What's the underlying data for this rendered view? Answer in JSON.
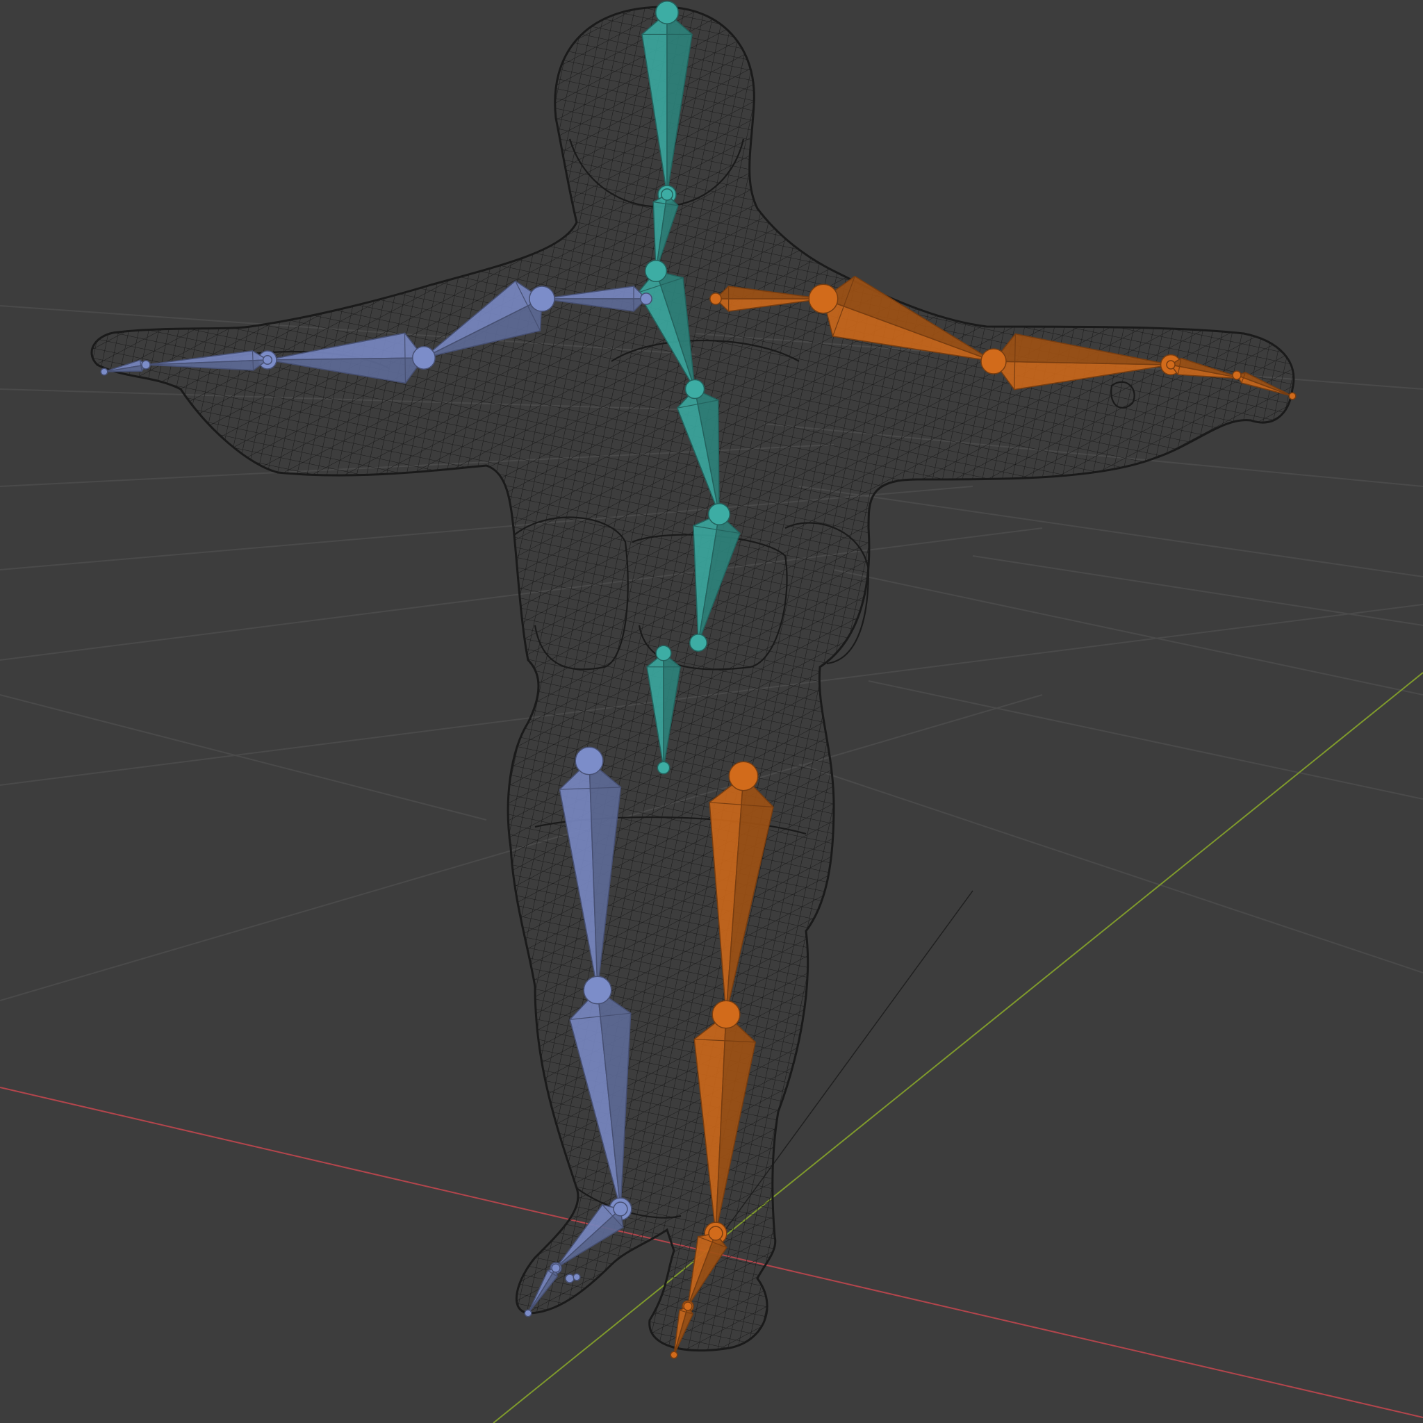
{
  "viewport": {
    "background": "#3d3d3d",
    "grid_color": "#4a4a4a",
    "x_axis_color": "#b3454c",
    "y_axis_color": "#7f9a2c",
    "wire_color": "#1a1a1a"
  },
  "armature": {
    "center_bone_color": "#3aa59c",
    "left_side_color": "#7686bf",
    "right_side_color": "#c8661a",
    "bones": [
      "head",
      "neck",
      "spine_upper",
      "spine_mid",
      "spine_lower",
      "hips",
      "shoulder_l",
      "upper_arm_l",
      "forearm_l",
      "hand_l",
      "shoulder_r",
      "upper_arm_r",
      "forearm_r",
      "hand_r",
      "thigh_l",
      "shin_l",
      "foot_l",
      "toe_l",
      "thigh_r",
      "shin_r",
      "foot_r",
      "toe_r"
    ]
  }
}
